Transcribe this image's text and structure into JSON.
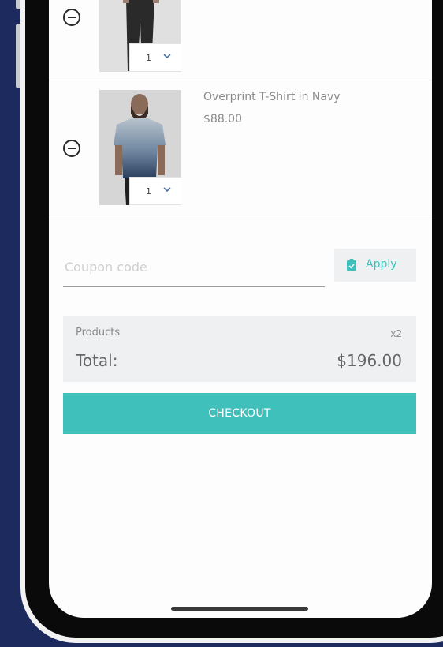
{
  "cart": {
    "items": [
      {
        "name": "",
        "price": "",
        "quantity": "1",
        "remove_icon": "minus-circle-icon",
        "image": "man in light shirt and dark trousers"
      },
      {
        "name": "Overprint T-Shirt in Navy",
        "price": "$88.00",
        "quantity": "1",
        "remove_icon": "minus-circle-icon",
        "image": "bearded man in gradient navy t-shirt"
      }
    ]
  },
  "coupon": {
    "placeholder": "Coupon code",
    "apply_label": "Apply",
    "apply_icon": "clipboard-check-icon"
  },
  "summary": {
    "products_label": "Products",
    "products_count": "x2",
    "total_label": "Total:",
    "total_value": "$196.00"
  },
  "checkout": {
    "label": "CHECKOUT"
  },
  "colors": {
    "accent": "#3fc0bb",
    "background": "#1c2a5e"
  }
}
